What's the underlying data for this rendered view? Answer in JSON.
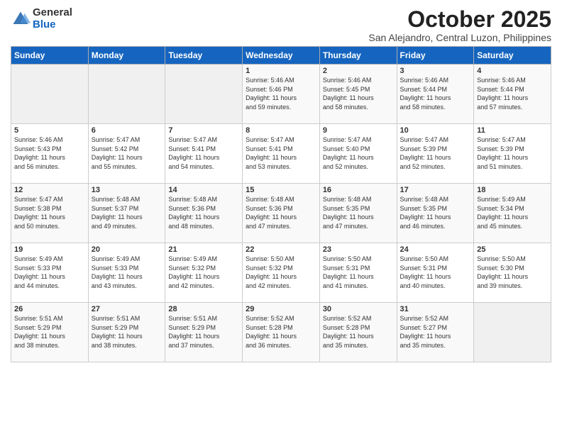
{
  "header": {
    "logo_general": "General",
    "logo_blue": "Blue",
    "month": "October 2025",
    "location": "San Alejandro, Central Luzon, Philippines"
  },
  "weekdays": [
    "Sunday",
    "Monday",
    "Tuesday",
    "Wednesday",
    "Thursday",
    "Friday",
    "Saturday"
  ],
  "weeks": [
    [
      {
        "day": "",
        "info": ""
      },
      {
        "day": "",
        "info": ""
      },
      {
        "day": "",
        "info": ""
      },
      {
        "day": "1",
        "info": "Sunrise: 5:46 AM\nSunset: 5:46 PM\nDaylight: 11 hours\nand 59 minutes."
      },
      {
        "day": "2",
        "info": "Sunrise: 5:46 AM\nSunset: 5:45 PM\nDaylight: 11 hours\nand 58 minutes."
      },
      {
        "day": "3",
        "info": "Sunrise: 5:46 AM\nSunset: 5:44 PM\nDaylight: 11 hours\nand 58 minutes."
      },
      {
        "day": "4",
        "info": "Sunrise: 5:46 AM\nSunset: 5:44 PM\nDaylight: 11 hours\nand 57 minutes."
      }
    ],
    [
      {
        "day": "5",
        "info": "Sunrise: 5:46 AM\nSunset: 5:43 PM\nDaylight: 11 hours\nand 56 minutes."
      },
      {
        "day": "6",
        "info": "Sunrise: 5:47 AM\nSunset: 5:42 PM\nDaylight: 11 hours\nand 55 minutes."
      },
      {
        "day": "7",
        "info": "Sunrise: 5:47 AM\nSunset: 5:41 PM\nDaylight: 11 hours\nand 54 minutes."
      },
      {
        "day": "8",
        "info": "Sunrise: 5:47 AM\nSunset: 5:41 PM\nDaylight: 11 hours\nand 53 minutes."
      },
      {
        "day": "9",
        "info": "Sunrise: 5:47 AM\nSunset: 5:40 PM\nDaylight: 11 hours\nand 52 minutes."
      },
      {
        "day": "10",
        "info": "Sunrise: 5:47 AM\nSunset: 5:39 PM\nDaylight: 11 hours\nand 52 minutes."
      },
      {
        "day": "11",
        "info": "Sunrise: 5:47 AM\nSunset: 5:39 PM\nDaylight: 11 hours\nand 51 minutes."
      }
    ],
    [
      {
        "day": "12",
        "info": "Sunrise: 5:47 AM\nSunset: 5:38 PM\nDaylight: 11 hours\nand 50 minutes."
      },
      {
        "day": "13",
        "info": "Sunrise: 5:48 AM\nSunset: 5:37 PM\nDaylight: 11 hours\nand 49 minutes."
      },
      {
        "day": "14",
        "info": "Sunrise: 5:48 AM\nSunset: 5:36 PM\nDaylight: 11 hours\nand 48 minutes."
      },
      {
        "day": "15",
        "info": "Sunrise: 5:48 AM\nSunset: 5:36 PM\nDaylight: 11 hours\nand 47 minutes."
      },
      {
        "day": "16",
        "info": "Sunrise: 5:48 AM\nSunset: 5:35 PM\nDaylight: 11 hours\nand 47 minutes."
      },
      {
        "day": "17",
        "info": "Sunrise: 5:48 AM\nSunset: 5:35 PM\nDaylight: 11 hours\nand 46 minutes."
      },
      {
        "day": "18",
        "info": "Sunrise: 5:49 AM\nSunset: 5:34 PM\nDaylight: 11 hours\nand 45 minutes."
      }
    ],
    [
      {
        "day": "19",
        "info": "Sunrise: 5:49 AM\nSunset: 5:33 PM\nDaylight: 11 hours\nand 44 minutes."
      },
      {
        "day": "20",
        "info": "Sunrise: 5:49 AM\nSunset: 5:33 PM\nDaylight: 11 hours\nand 43 minutes."
      },
      {
        "day": "21",
        "info": "Sunrise: 5:49 AM\nSunset: 5:32 PM\nDaylight: 11 hours\nand 42 minutes."
      },
      {
        "day": "22",
        "info": "Sunrise: 5:50 AM\nSunset: 5:32 PM\nDaylight: 11 hours\nand 42 minutes."
      },
      {
        "day": "23",
        "info": "Sunrise: 5:50 AM\nSunset: 5:31 PM\nDaylight: 11 hours\nand 41 minutes."
      },
      {
        "day": "24",
        "info": "Sunrise: 5:50 AM\nSunset: 5:31 PM\nDaylight: 11 hours\nand 40 minutes."
      },
      {
        "day": "25",
        "info": "Sunrise: 5:50 AM\nSunset: 5:30 PM\nDaylight: 11 hours\nand 39 minutes."
      }
    ],
    [
      {
        "day": "26",
        "info": "Sunrise: 5:51 AM\nSunset: 5:29 PM\nDaylight: 11 hours\nand 38 minutes."
      },
      {
        "day": "27",
        "info": "Sunrise: 5:51 AM\nSunset: 5:29 PM\nDaylight: 11 hours\nand 38 minutes."
      },
      {
        "day": "28",
        "info": "Sunrise: 5:51 AM\nSunset: 5:29 PM\nDaylight: 11 hours\nand 37 minutes."
      },
      {
        "day": "29",
        "info": "Sunrise: 5:52 AM\nSunset: 5:28 PM\nDaylight: 11 hours\nand 36 minutes."
      },
      {
        "day": "30",
        "info": "Sunrise: 5:52 AM\nSunset: 5:28 PM\nDaylight: 11 hours\nand 35 minutes."
      },
      {
        "day": "31",
        "info": "Sunrise: 5:52 AM\nSunset: 5:27 PM\nDaylight: 11 hours\nand 35 minutes."
      },
      {
        "day": "",
        "info": ""
      }
    ]
  ]
}
